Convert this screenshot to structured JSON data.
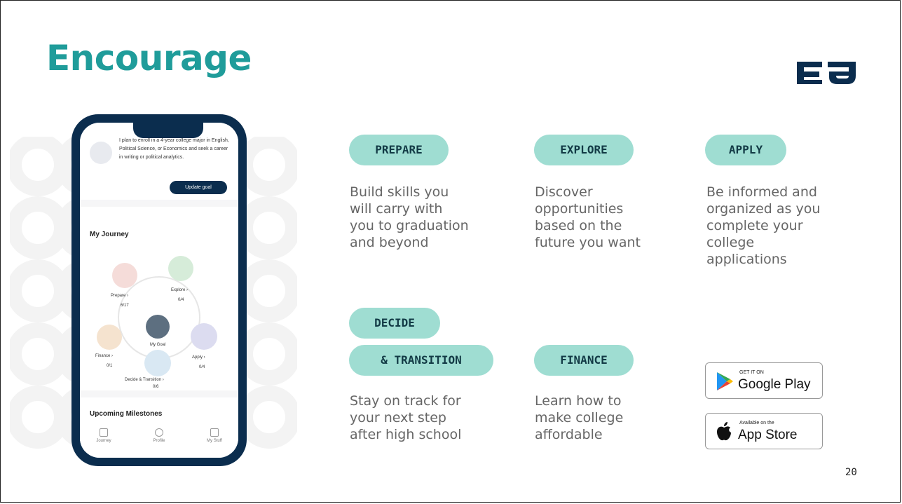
{
  "title": "Encourage",
  "phone": {
    "goal_text": "I plan to enroll in a 4-year college major in English, Political Science, or Economics and seek a career in writing or political analytics.",
    "update_button": "Update goal",
    "journey_title": "My Journey",
    "nodes": {
      "prepare": {
        "label": "Prepare ›",
        "count": "6/17"
      },
      "explore": {
        "label": "Explore ›",
        "count": "0/4"
      },
      "finance": {
        "label": "Finance ›",
        "count": "0/1"
      },
      "apply": {
        "label": "Apply ›",
        "count": "0/4"
      },
      "decide": {
        "label": "Decide & Transition ›",
        "count": "0/6"
      },
      "center": {
        "label": "My Goal"
      }
    },
    "milestones_title": "Upcoming Milestones",
    "tabs": [
      "Journey",
      "Profile",
      "My Stuff"
    ]
  },
  "stages": {
    "prepare": {
      "label": "PREPARE",
      "desc": [
        "Build skills you",
        "will carry with",
        "you to graduation",
        "and beyond"
      ]
    },
    "explore": {
      "label": "EXPLORE",
      "desc": [
        "Discover",
        "opportunities",
        "based on the",
        "future you want"
      ]
    },
    "apply": {
      "label": "APPLY",
      "desc": [
        "Be informed and",
        "organized as you",
        "complete your",
        "college",
        "applications"
      ]
    },
    "decide": {
      "label1": "DECIDE",
      "label2": "& TRANSITION",
      "desc": [
        "Stay on track for",
        "your next step",
        "after high school"
      ]
    },
    "finance": {
      "label": "FINANCE",
      "desc": [
        "Learn how to",
        "make college",
        "affordable"
      ]
    }
  },
  "stores": {
    "google": {
      "small": "GET IT ON",
      "big": "Google Play"
    },
    "apple": {
      "small": "Available on the",
      "big": "App Store"
    }
  },
  "page_number": "20",
  "colors": {
    "accent": "#1f9c9a",
    "pill": "#9fddd2",
    "navy": "#0b2d4e"
  }
}
